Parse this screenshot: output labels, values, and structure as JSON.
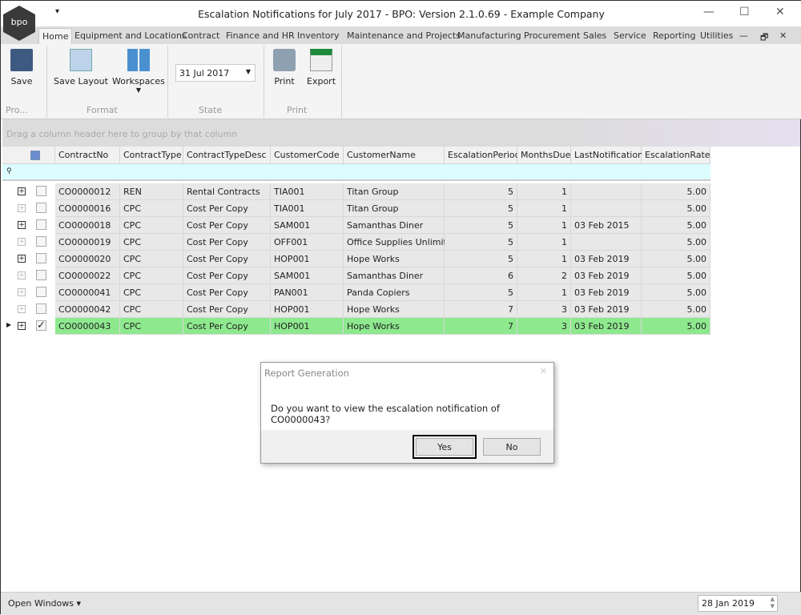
{
  "window": {
    "title": "Escalation Notifications for July 2017 - BPO: Version 2.1.0.69 - Example Company",
    "logo": "bpo"
  },
  "tabs": [
    "Home",
    "Equipment and Locations",
    "Contract",
    "Finance and HR",
    "Inventory",
    "Maintenance and Projects",
    "Manufacturing",
    "Procurement",
    "Sales",
    "Service",
    "Reporting",
    "Utilities"
  ],
  "ribbon": {
    "save": "Save",
    "save_layout": "Save Layout",
    "workspaces": "Workspaces",
    "date": "31 Jul 2017",
    "print": "Print",
    "export": "Export",
    "groups": {
      "pro": "Pro...",
      "format": "Format",
      "state": "State",
      "print": "Print"
    }
  },
  "groupbar": "Drag a column header here to group by that column",
  "grid": {
    "columns": [
      "ContractNo",
      "ContractType",
      "ContractTypeDesc",
      "CustomerCode",
      "CustomerName",
      "EscalationPeriod",
      "MonthsDue",
      "LastNotification",
      "EscalationRate"
    ],
    "rows": [
      [
        "CO0000012",
        "REN",
        "Rental Contracts",
        "TIA001",
        "Titan Group",
        "5",
        "1",
        "",
        "5.00"
      ],
      [
        "CO0000016",
        "CPC",
        "Cost Per Copy",
        "TIA001",
        "Titan Group",
        "5",
        "1",
        "",
        "5.00"
      ],
      [
        "CO0000018",
        "CPC",
        "Cost Per Copy",
        "SAM001",
        "Samanthas Diner",
        "5",
        "1",
        "03 Feb 2015",
        "5.00"
      ],
      [
        "CO0000019",
        "CPC",
        "Cost Per Copy",
        "OFF001",
        "Office Supplies Unlimited",
        "5",
        "1",
        "",
        "5.00"
      ],
      [
        "CO0000020",
        "CPC",
        "Cost Per Copy",
        "HOP001",
        "Hope Works",
        "5",
        "1",
        "03 Feb 2019",
        "5.00"
      ],
      [
        "CO0000022",
        "CPC",
        "Cost Per Copy",
        "SAM001",
        "Samanthas Diner",
        "6",
        "2",
        "03 Feb 2019",
        "5.00"
      ],
      [
        "CO0000041",
        "CPC",
        "Cost Per Copy",
        "PAN001",
        "Panda Copiers",
        "5",
        "1",
        "03 Feb 2019",
        "5.00"
      ],
      [
        "CO0000042",
        "CPC",
        "Cost Per Copy",
        "HOP001",
        "Hope Works",
        "7",
        "3",
        "03 Feb 2019",
        "5.00"
      ],
      [
        "CO0000043",
        "CPC",
        "Cost Per Copy",
        "HOP001",
        "Hope Works",
        "7",
        "3",
        "03 Feb 2019",
        "5.00"
      ]
    ],
    "expand_dark": [
      true,
      false,
      true,
      false,
      true,
      false,
      false,
      false,
      true
    ],
    "checked": [
      false,
      false,
      false,
      false,
      false,
      false,
      false,
      false,
      true
    ],
    "selected_row": 8
  },
  "dialog": {
    "title": "Report Generation",
    "message": "Do you want to view the escalation notification of CO0000043?",
    "yes": "Yes",
    "no": "No"
  },
  "status": {
    "open_windows": "Open Windows",
    "date": "28 Jan 2019"
  }
}
